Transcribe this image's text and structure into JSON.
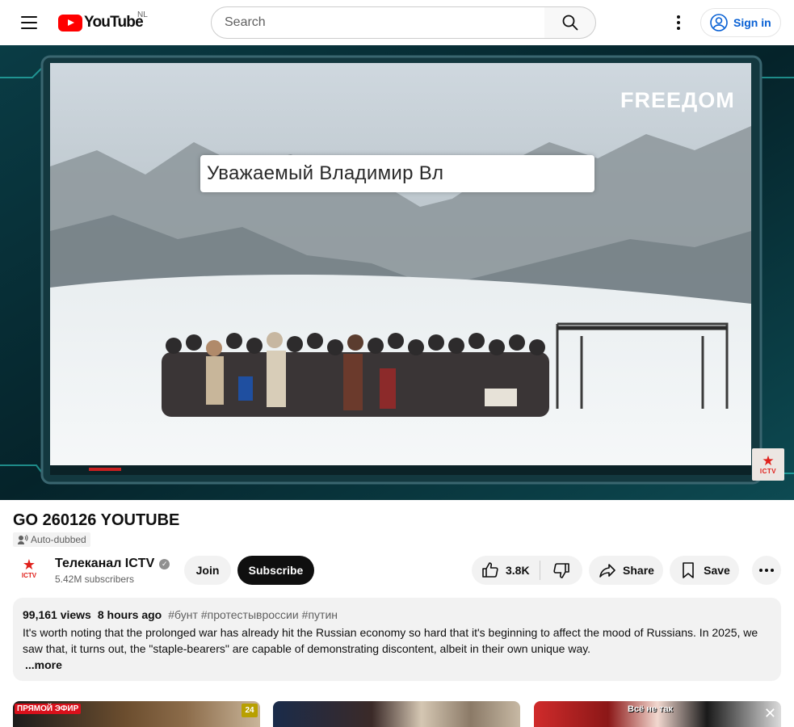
{
  "header": {
    "menu_icon": "hamburger-menu-icon",
    "logo_text": "YouTube",
    "country_code": "NL",
    "search_placeholder": "Search",
    "search_icon": "search-icon",
    "settings_icon": "kebab-menu-icon",
    "signin_label": "Sign in",
    "signin_icon": "account-circle-icon"
  },
  "player": {
    "overlay_logo": "FREEДOM",
    "caption": "Уважаемый Владимир Вл",
    "corner_logo": "ICTV"
  },
  "video": {
    "title": "GO 260126 YOUTUBE",
    "auto_dubbed": "Auto-dubbed"
  },
  "channel": {
    "name": "Телеканал ICTV",
    "verified": true,
    "avatar_label": "ICTV",
    "subscribers": "5.42M subscribers",
    "join_label": "Join",
    "subscribe_label": "Subscribe"
  },
  "actions": {
    "like_count": "3.8K",
    "share_label": "Share",
    "save_label": "Save"
  },
  "description": {
    "views": "99,161 views",
    "time_ago": "8 hours ago",
    "tags": [
      "#бунт",
      "#протестывроссии",
      "#путин"
    ],
    "text": "It's worth noting that the prolonged war has already hit the Russian economy so hard that it's beginning to affect the mood of Russians. In 2025, we saw that, it turns out, the \"staple-bearers\" are capable of demonstrating discontent, albeit in their own unique way.",
    "more_label": "...more"
  },
  "related": [
    {
      "badge": "ПРЯМОЙ ЭФИР",
      "channel_badge": "24"
    },
    {},
    {
      "overlay_text": "Всё не так",
      "icon": "close-icon"
    }
  ],
  "colors": {
    "brand_red": "#ff0000",
    "link_blue": "#065fd4",
    "subscribe_bg": "#0f0f0f",
    "chip_bg": "#f2f2f2"
  }
}
